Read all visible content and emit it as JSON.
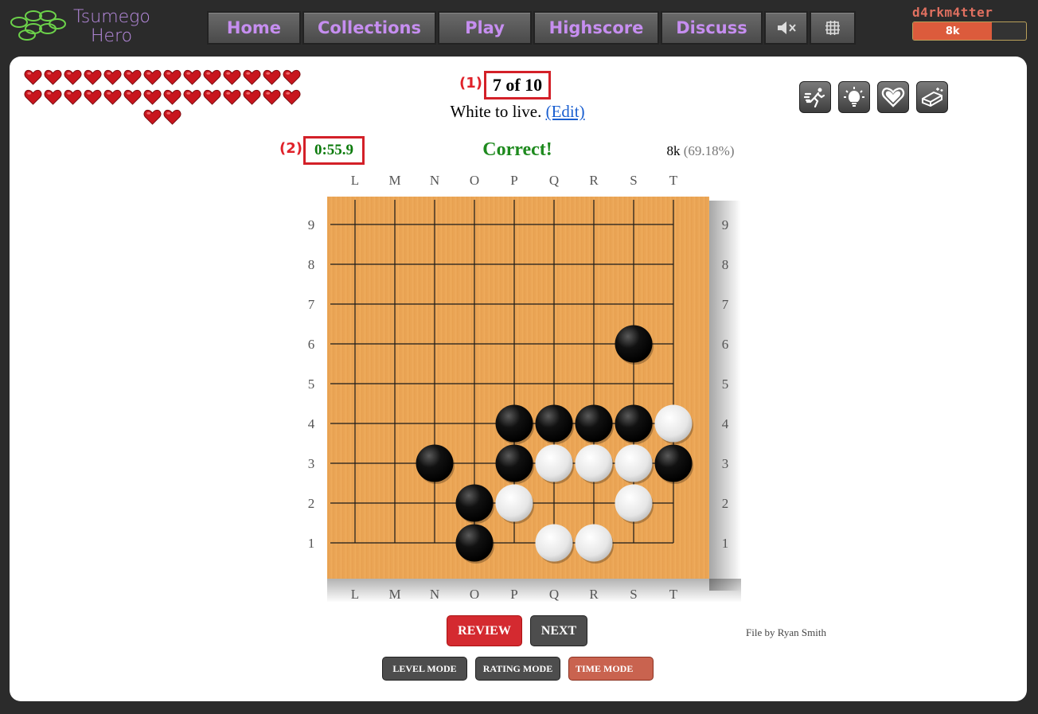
{
  "header": {
    "logo_line1": "Tsumego",
    "logo_line2": "Hero",
    "nav": [
      "Home",
      "Collections",
      "Play",
      "Highscore",
      "Discuss"
    ],
    "mute_icon": "speaker-muted-icon",
    "board_icon": "grid-icon",
    "user": {
      "name": "d4rkm4tter",
      "rank": "8k",
      "progress": 0.7
    }
  },
  "hearts": {
    "count": 30,
    "color": "#c8161e"
  },
  "problem": {
    "marker1": "(1)",
    "counter": "7 of 10",
    "instruction": "White to live.",
    "edit_link": "(Edit)",
    "marker2": "(2)",
    "timer": "0:55.9",
    "status": "Correct!",
    "rank": "8k",
    "rank_pct": "(69.18%)"
  },
  "tools": [
    "running-man-icon",
    "lightbulb-icon",
    "heart-icon",
    "eraser-icon"
  ],
  "board": {
    "columns": [
      "L",
      "M",
      "N",
      "O",
      "P",
      "Q",
      "R",
      "S",
      "T"
    ],
    "rows": [
      "9",
      "8",
      "7",
      "6",
      "5",
      "4",
      "3",
      "2",
      "1"
    ],
    "black": [
      "S6",
      "P4",
      "Q4",
      "R4",
      "S4",
      "N3",
      "P3",
      "T3",
      "O2",
      "O1"
    ],
    "white": [
      "T4",
      "Q3",
      "R3",
      "S3",
      "P2",
      "S2",
      "Q1",
      "R1"
    ]
  },
  "credit": "File by Ryan Smith",
  "buttons": {
    "review": "REVIEW",
    "next": "NEXT"
  },
  "modes": {
    "level": "LEVEL MODE",
    "rating": "RATING MODE",
    "time": "TIME MODE"
  }
}
